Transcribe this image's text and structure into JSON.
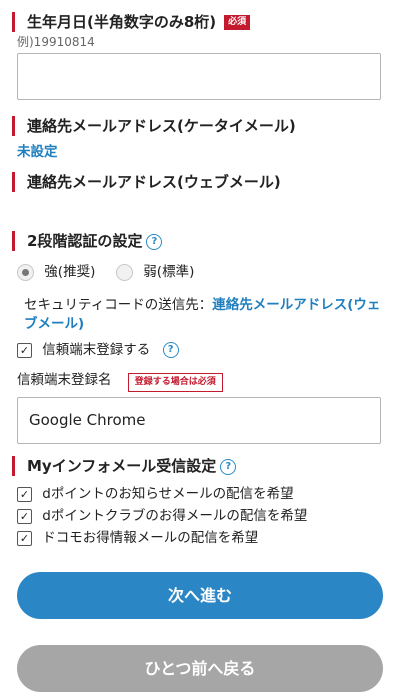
{
  "birthdate": {
    "label": "生年月日(半角数字のみ8桁)",
    "required_badge": "必須",
    "example": "例)19910814",
    "value": ""
  },
  "mobile_email": {
    "label": "連絡先メールアドレス(ケータイメール)",
    "status": "未設定"
  },
  "web_email": {
    "label": "連絡先メールアドレス(ウェブメール)"
  },
  "two_factor": {
    "label": "2段階認証の設定",
    "help_glyph": "?",
    "option_strong": "強(推奨)",
    "option_weak": "弱(標準)",
    "selected": "強(推奨)",
    "destination_prefix": "セキュリティコードの送信先：",
    "destination_link": "連絡先メールアドレス(ウェブメール)",
    "trusted_device_check": "信頼端末登録する",
    "trusted_device_checked": true,
    "trusted_name_label": "信頼端末登録名",
    "trusted_name_badge": "登録する場合は必須",
    "trusted_name_value": "Google Chrome"
  },
  "my_info_mail": {
    "label": "Myインフォメール受信設定",
    "options": [
      {
        "label": "dポイントのお知らせメールの配信を希望",
        "checked": true
      },
      {
        "label": "dポイントクラブのお得メールの配信を希望",
        "checked": true
      },
      {
        "label": "ドコモお得情報メールの配信を希望",
        "checked": true
      }
    ]
  },
  "buttons": {
    "next": "次へ進む",
    "back": "ひとつ前へ戻る"
  },
  "colors": {
    "accent_red": "#c41a2e",
    "primary_button": "#2a86c4",
    "secondary_button": "#a6a6a6",
    "link": "#1f7fbf"
  }
}
